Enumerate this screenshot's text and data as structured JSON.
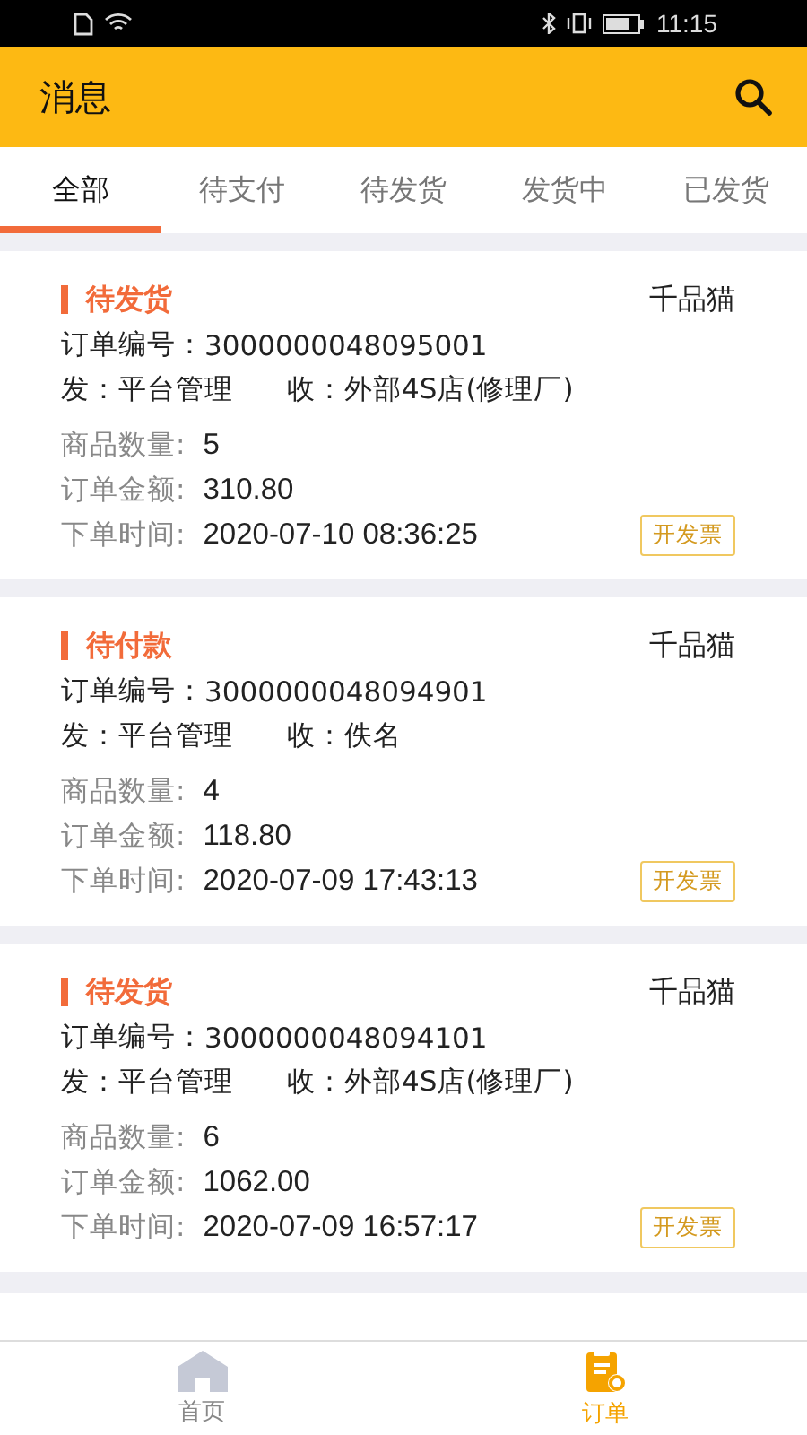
{
  "status_bar": {
    "time": "11:15"
  },
  "header": {
    "title": "消息"
  },
  "tabs": [
    {
      "label": "全部",
      "selected": true
    },
    {
      "label": "待支付",
      "selected": false
    },
    {
      "label": "待发货",
      "selected": false
    },
    {
      "label": "发货中",
      "selected": false
    },
    {
      "label": "已发货",
      "selected": false
    }
  ],
  "orders": [
    {
      "status": "待发货",
      "shop": "千品猫",
      "order_no_label": "订单编号：",
      "order_no": "3000000048095001",
      "sender_label": "发：",
      "sender": "平台管理",
      "receiver_label": "收：",
      "receiver": "外部4S店(修理厂)",
      "qty_label": "商品数量:",
      "qty": "5",
      "amount_label": "订单金额:",
      "amount": "310.80",
      "time_label": "下单时间:",
      "time": "2020-07-10 08:36:25",
      "invoice_button": "开发票"
    },
    {
      "status": "待付款",
      "shop": "千品猫",
      "order_no_label": "订单编号：",
      "order_no": "3000000048094901",
      "sender_label": "发：",
      "sender": "平台管理",
      "receiver_label": "收：",
      "receiver": "佚名",
      "qty_label": "商品数量:",
      "qty": "4",
      "amount_label": "订单金额:",
      "amount": "118.80",
      "time_label": "下单时间:",
      "time": "2020-07-09 17:43:13",
      "invoice_button": "开发票"
    },
    {
      "status": "待发货",
      "shop": "千品猫",
      "order_no_label": "订单编号：",
      "order_no": "3000000048094101",
      "sender_label": "发：",
      "sender": "平台管理",
      "receiver_label": "收：",
      "receiver": "外部4S店(修理厂)",
      "qty_label": "商品数量:",
      "qty": "6",
      "amount_label": "订单金额:",
      "amount": "1062.00",
      "time_label": "下单时间:",
      "time": "2020-07-09 16:57:17",
      "invoice_button": "开发票"
    }
  ],
  "bottom_nav": [
    {
      "label": "首页",
      "kind": "home",
      "selected": false
    },
    {
      "label": "订单",
      "kind": "order",
      "selected": true
    }
  ]
}
